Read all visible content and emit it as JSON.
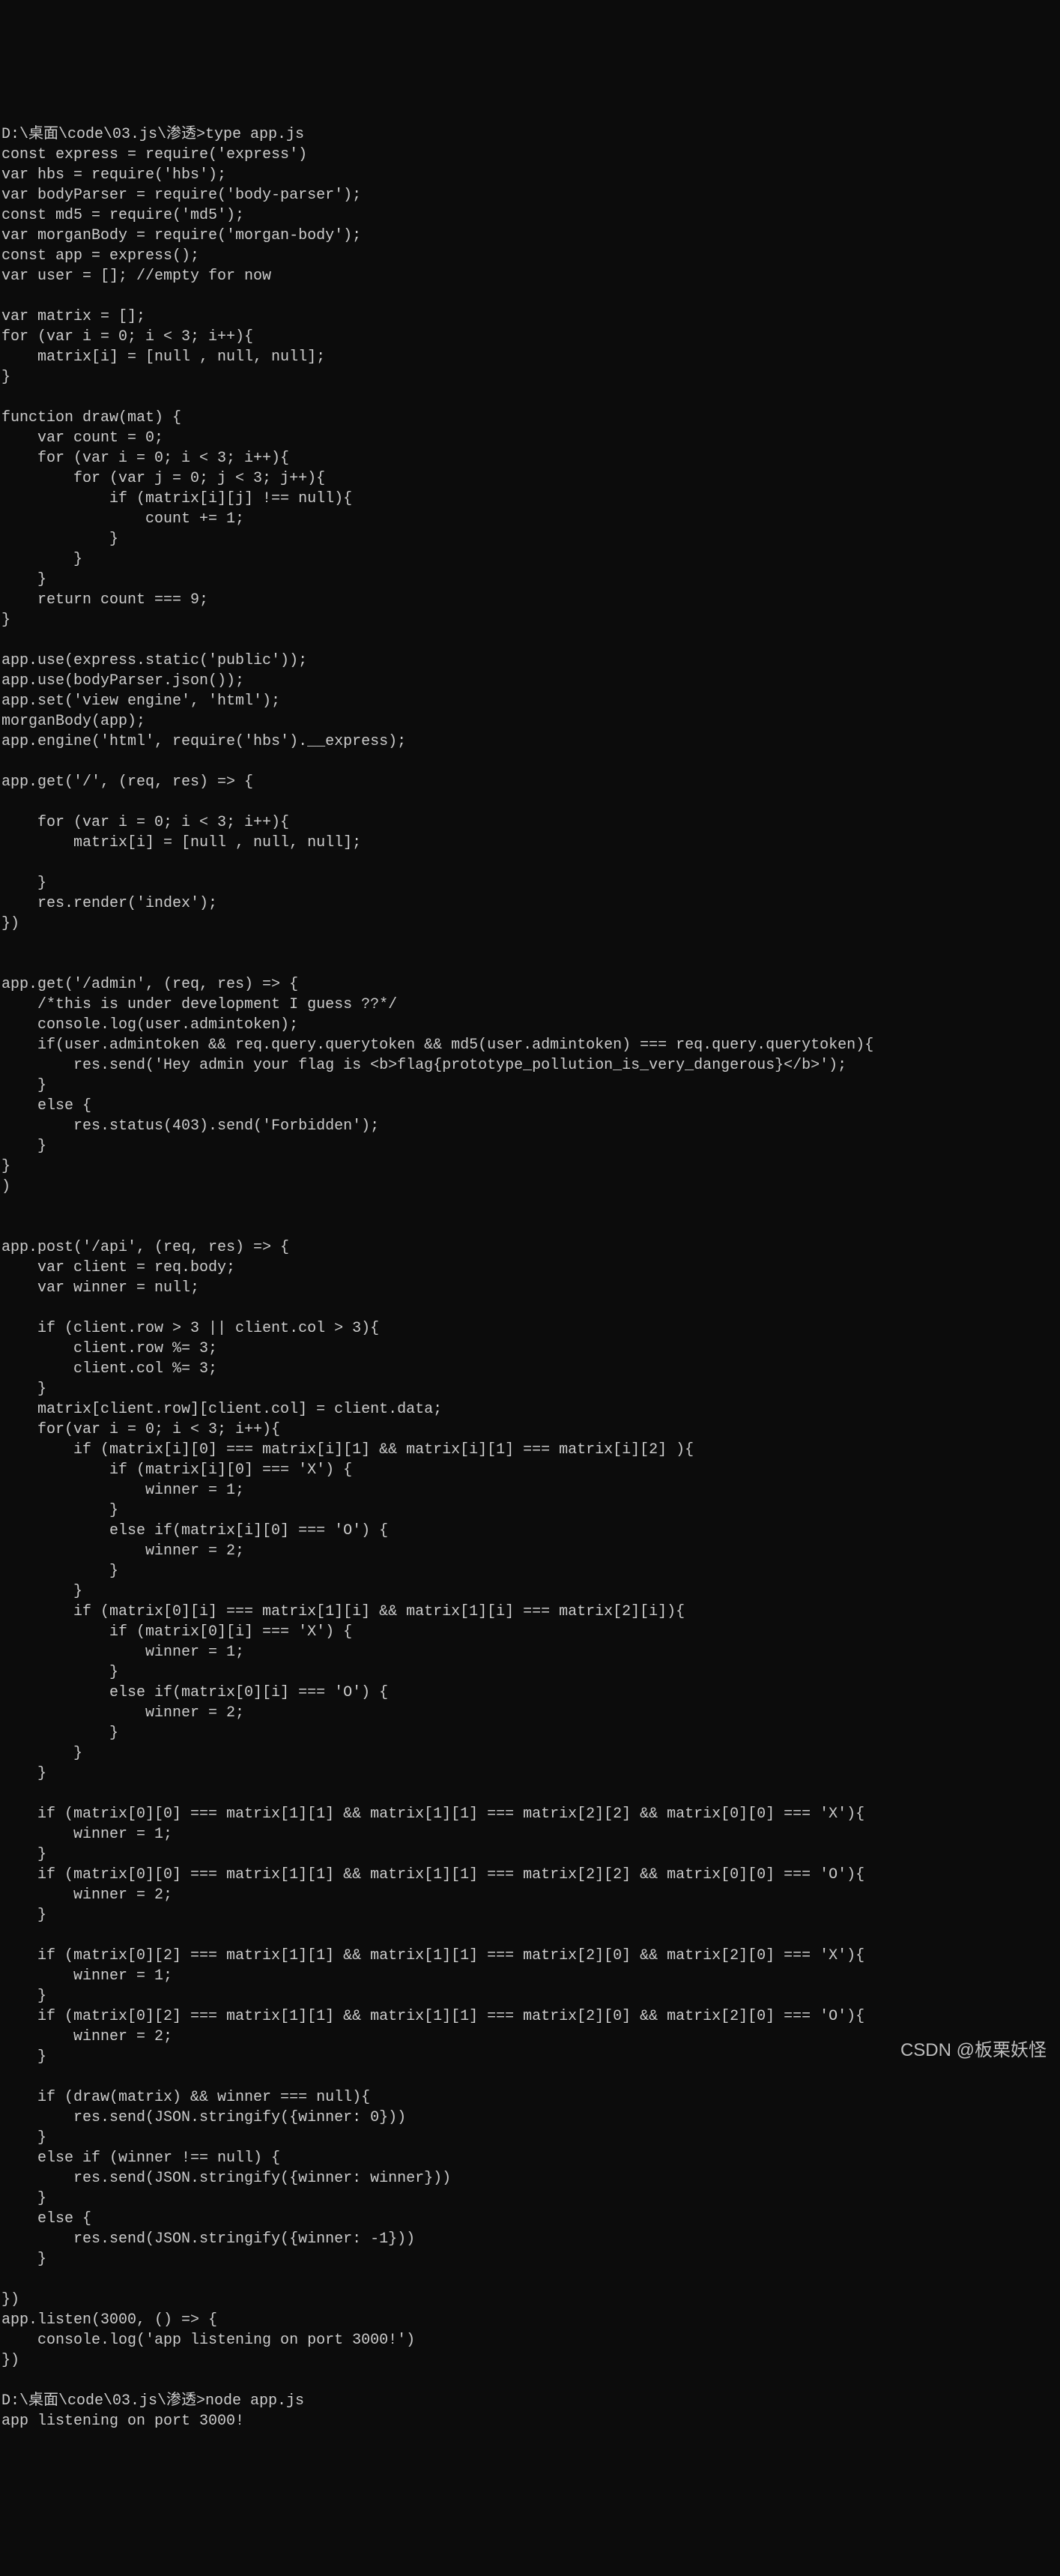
{
  "terminal": {
    "prompt1": "D:\\桌面\\code\\03.js\\渗透>type app.js",
    "code": [
      "const express = require('express')",
      "var hbs = require('hbs');",
      "var bodyParser = require('body-parser');",
      "const md5 = require('md5');",
      "var morganBody = require('morgan-body');",
      "const app = express();",
      "var user = []; //empty for now",
      "",
      "var matrix = [];",
      "for (var i = 0; i < 3; i++){",
      "    matrix[i] = [null , null, null];",
      "}",
      "",
      "function draw(mat) {",
      "    var count = 0;",
      "    for (var i = 0; i < 3; i++){",
      "        for (var j = 0; j < 3; j++){",
      "            if (matrix[i][j] !== null){",
      "                count += 1;",
      "            }",
      "        }",
      "    }",
      "    return count === 9;",
      "}",
      "",
      "app.use(express.static('public'));",
      "app.use(bodyParser.json());",
      "app.set('view engine', 'html');",
      "morganBody(app);",
      "app.engine('html', require('hbs').__express);",
      "",
      "app.get('/', (req, res) => {",
      "",
      "    for (var i = 0; i < 3; i++){",
      "        matrix[i] = [null , null, null];",
      "",
      "    }",
      "    res.render('index');",
      "})",
      "",
      "",
      "app.get('/admin', (req, res) => {",
      "    /*this is under development I guess ??*/",
      "    console.log(user.admintoken);",
      "    if(user.admintoken && req.query.querytoken && md5(user.admintoken) === req.query.querytoken){",
      "        res.send('Hey admin your flag is <b>flag{prototype_pollution_is_very_dangerous}</b>');",
      "    }",
      "    else {",
      "        res.status(403).send('Forbidden');",
      "    }",
      "}",
      ")",
      "",
      "",
      "app.post('/api', (req, res) => {",
      "    var client = req.body;",
      "    var winner = null;",
      "",
      "    if (client.row > 3 || client.col > 3){",
      "        client.row %= 3;",
      "        client.col %= 3;",
      "    }",
      "    matrix[client.row][client.col] = client.data;",
      "    for(var i = 0; i < 3; i++){",
      "        if (matrix[i][0] === matrix[i][1] && matrix[i][1] === matrix[i][2] ){",
      "            if (matrix[i][0] === 'X') {",
      "                winner = 1;",
      "            }",
      "            else if(matrix[i][0] === 'O') {",
      "                winner = 2;",
      "            }",
      "        }",
      "        if (matrix[0][i] === matrix[1][i] && matrix[1][i] === matrix[2][i]){",
      "            if (matrix[0][i] === 'X') {",
      "                winner = 1;",
      "            }",
      "            else if(matrix[0][i] === 'O') {",
      "                winner = 2;",
      "            }",
      "        }",
      "    }",
      "",
      "    if (matrix[0][0] === matrix[1][1] && matrix[1][1] === matrix[2][2] && matrix[0][0] === 'X'){",
      "        winner = 1;",
      "    }",
      "    if (matrix[0][0] === matrix[1][1] && matrix[1][1] === matrix[2][2] && matrix[0][0] === 'O'){",
      "        winner = 2;",
      "    }",
      "",
      "    if (matrix[0][2] === matrix[1][1] && matrix[1][1] === matrix[2][0] && matrix[2][0] === 'X'){",
      "        winner = 1;",
      "    }",
      "    if (matrix[0][2] === matrix[1][1] && matrix[1][1] === matrix[2][0] && matrix[2][0] === 'O'){",
      "        winner = 2;",
      "    }",
      "",
      "    if (draw(matrix) && winner === null){",
      "        res.send(JSON.stringify({winner: 0}))",
      "    }",
      "    else if (winner !== null) {",
      "        res.send(JSON.stringify({winner: winner}))",
      "    }",
      "    else {",
      "        res.send(JSON.stringify({winner: -1}))",
      "    }",
      "",
      "})",
      "app.listen(3000, () => {",
      "    console.log('app listening on port 3000!')",
      "})"
    ],
    "prompt2": "D:\\桌面\\code\\03.js\\渗透>node app.js",
    "output": "app listening on port 3000!"
  },
  "watermark": "CSDN @板栗妖怪"
}
